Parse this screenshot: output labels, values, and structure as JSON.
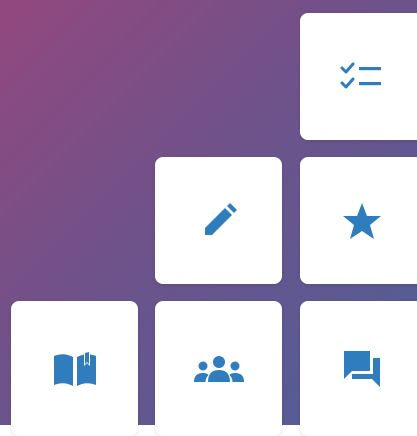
{
  "colors": {
    "background_start": "#92487e",
    "background_end": "#4f5f98",
    "tile_background": "#ffffff",
    "icon_color": "#2f7dbc"
  },
  "tiles": [
    {
      "id": "checklist",
      "icon": "checklist-icon"
    },
    {
      "id": "edit",
      "icon": "pencil-icon"
    },
    {
      "id": "favorites",
      "icon": "star-icon"
    },
    {
      "id": "library",
      "icon": "open-book-icon"
    },
    {
      "id": "groups",
      "icon": "people-group-icon"
    },
    {
      "id": "messages",
      "icon": "chat-bubbles-icon"
    }
  ]
}
